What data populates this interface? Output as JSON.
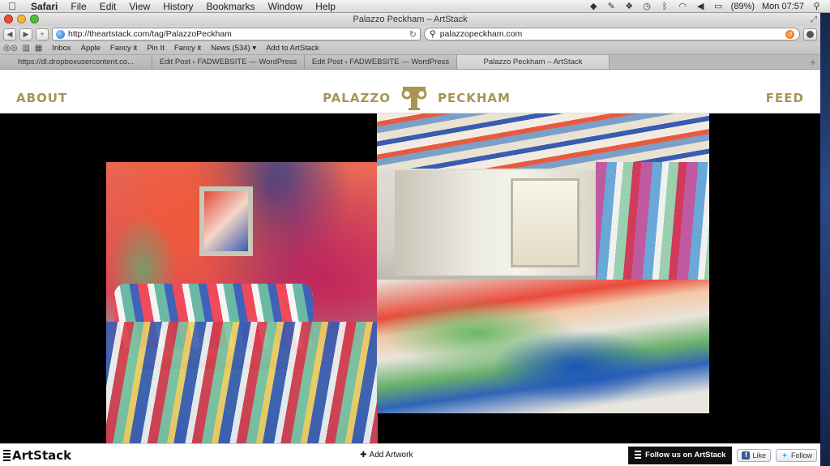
{
  "menubar": {
    "apple": "",
    "items": [
      "Safari",
      "File",
      "Edit",
      "View",
      "History",
      "Bookmarks",
      "Window",
      "Help"
    ],
    "battery": "(89%)",
    "clock": "Mon 07:57"
  },
  "window": {
    "title": "Palazzo Peckham – ArtStack"
  },
  "toolbar": {
    "url": "http://theartstack.com/tag/PalazzoPeckham",
    "search_value": "palazzopeckham.com"
  },
  "bookmarks": {
    "items": [
      "Inbox",
      "Apple",
      "Fancy it",
      "Pin It",
      "Fancy it",
      "News (534) ▾",
      "Add to ArtStack"
    ]
  },
  "tabs": [
    {
      "label": "https://dl.dropboxusercontent.co..."
    },
    {
      "label": "Edit Post ‹ FADWEBSITE — WordPress"
    },
    {
      "label": "Edit Post ‹ FADWEBSITE — WordPress"
    },
    {
      "label": "Palazzo Peckham – ArtStack"
    }
  ],
  "site": {
    "nav_left": "ABOUT",
    "brand_left": "PALAZZO",
    "brand_right": "PECKHAM",
    "nav_right": "FEED",
    "brand_color": "#a99454"
  },
  "footer": {
    "logo": "ArtStack",
    "add_artwork": "Add Artwork",
    "follow": "Follow us on ArtStack",
    "like": "Like",
    "twitter_follow": "Follow"
  }
}
